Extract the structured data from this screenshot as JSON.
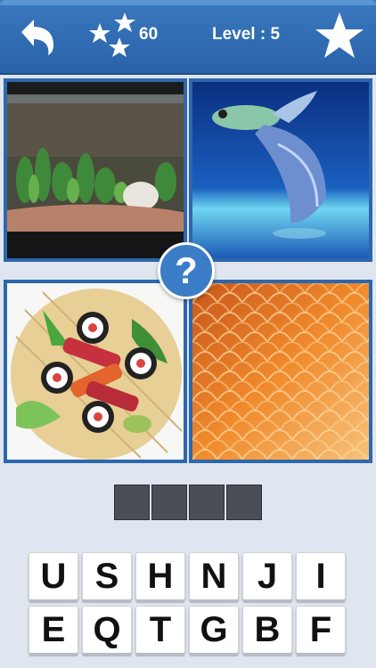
{
  "header": {
    "score": "60",
    "level": "Level : 5",
    "back_icon": "back-arrow-icon",
    "stars_icon": "stars-icon",
    "star_icon": "star-icon"
  },
  "pictures": [
    {
      "name": "aquarium",
      "desc": "aquarium tank"
    },
    {
      "name": "guppy",
      "desc": "tropical fish"
    },
    {
      "name": "sushi",
      "desc": "sushi"
    },
    {
      "name": "scales",
      "desc": "fish scales"
    }
  ],
  "hint": "?",
  "answer_slots": 4,
  "keyboard": {
    "row1": [
      "U",
      "S",
      "H",
      "N",
      "J",
      "I"
    ],
    "row2": [
      "E",
      "Q",
      "T",
      "G",
      "B",
      "F"
    ]
  },
  "colors": {
    "header": "#2f6bb3",
    "accent": "#3b7dc6",
    "background": "#dfe6ef"
  }
}
